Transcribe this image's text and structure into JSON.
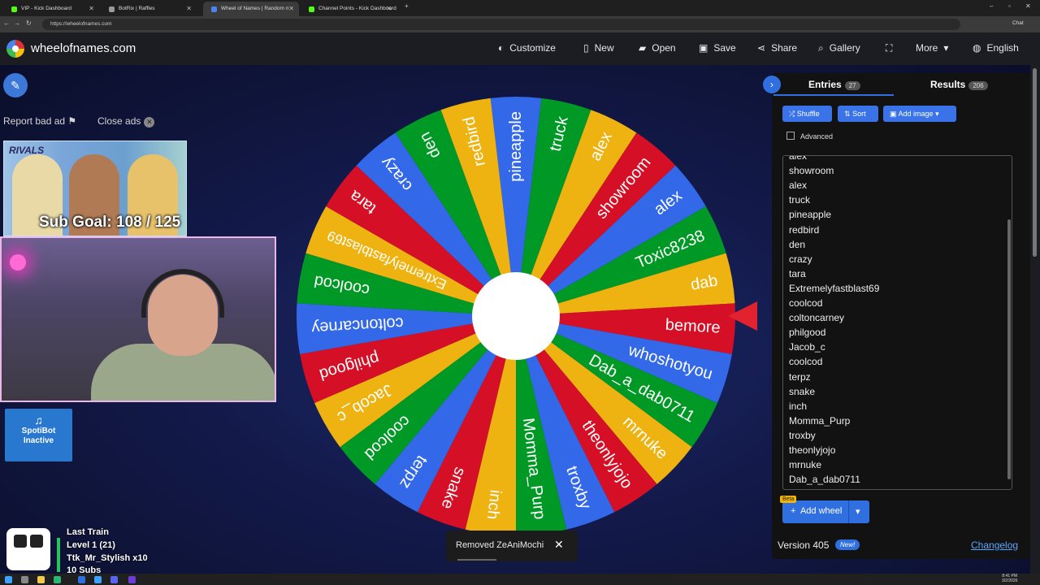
{
  "browser": {
    "tabs": [
      {
        "title": "VIP - Kick Dashboard",
        "color": "#53fc18"
      },
      {
        "title": "BotRix | Raffles",
        "color": "#9a9a9a"
      },
      {
        "title": "Wheel of Names | Random n",
        "color": "#4885ed"
      },
      {
        "title": "Channel Points - Kick Dashboard",
        "color": "#53fc18"
      }
    ],
    "url": "https://wheelofnames.com",
    "chat_label": "Chat"
  },
  "site": {
    "name": "wheelofnames.com",
    "nav": [
      {
        "label": "Customize",
        "icon": "palette-icon"
      },
      {
        "label": "New",
        "icon": "document-icon"
      },
      {
        "label": "Open",
        "icon": "folder-icon"
      },
      {
        "label": "Save",
        "icon": "save-icon"
      },
      {
        "label": "Share",
        "icon": "share-icon"
      },
      {
        "label": "Gallery",
        "icon": "search-icon"
      },
      {
        "label": "",
        "icon": "fullscreen-icon"
      },
      {
        "label": "More",
        "icon": "chevron-down-icon"
      },
      {
        "label": "English",
        "icon": "globe-icon"
      }
    ]
  },
  "ads": {
    "report": "Report bad ad",
    "close": "Close ads",
    "banner_text": "RIVALS"
  },
  "overlay": {
    "sub_goal": "Sub Goal: 108 / 125",
    "spotibot": [
      "SpotiBot",
      "Inactive"
    ],
    "train": [
      "Last Train",
      "Level 1  (21)",
      "Ttk_Mr_Stylish x10",
      "10 Subs"
    ]
  },
  "wheel": {
    "colors": [
      "#3369e8",
      "#009925",
      "#eeb211",
      "#d50f25"
    ],
    "segments": [
      "pineapple",
      "truck",
      "alex",
      "showroom",
      "alex",
      "Toxic8238",
      "dab",
      "bemore",
      "whoshotyou",
      "Dab_a_dab0711",
      "mrnuke",
      "theonlyjojo",
      "troxby",
      "Momma_Purp",
      "inch",
      "snake",
      "terpz",
      "coolcod",
      "Jacob_c",
      "philgood",
      "coltoncarney",
      "coolcod",
      "Extremelyfastblast69",
      "tara",
      "crazy",
      "den",
      "redbird"
    ]
  },
  "toast": {
    "message": "Removed ZeAniMochi"
  },
  "panel": {
    "tabs": [
      {
        "label": "Entries",
        "count": "27"
      },
      {
        "label": "Results",
        "count": "206"
      }
    ],
    "buttons": [
      {
        "label": "Shuffle",
        "icon": "shuffle-icon"
      },
      {
        "label": "Sort",
        "icon": "sort-icon"
      },
      {
        "label": "Add image",
        "icon": "image-icon"
      }
    ],
    "advanced_label": "Advanced",
    "entries": [
      "alex",
      "showroom",
      "alex",
      "truck",
      "pineapple",
      "redbird",
      "den",
      "crazy",
      "tara",
      "Extremelyfastblast69",
      "coolcod",
      "coltoncarney",
      "philgood",
      "Jacob_c",
      "coolcod",
      "terpz",
      "snake",
      "inch",
      "Momma_Purp",
      "troxby",
      "theonlyjojo",
      "mrnuke",
      "Dab_a_dab0711"
    ],
    "beta": "Beta",
    "add_wheel": "Add wheel",
    "version": "Version 405",
    "new_badge": "New!",
    "changelog": "Changelog"
  },
  "taskbar": {
    "time": "8:41 PM",
    "date": "3/2/2026"
  }
}
